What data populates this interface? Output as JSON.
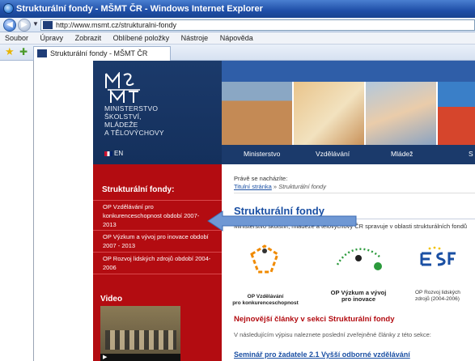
{
  "browser": {
    "title": "Strukturální fondy - MŠMT ČR - Windows Internet Explorer",
    "url": "http://www.msmt.cz/strukturalni-fondy",
    "menu": [
      "Soubor",
      "Úpravy",
      "Zobrazit",
      "Oblíbené položky",
      "Nástroje",
      "Nápověda"
    ],
    "tab_title": "Strukturální fondy - MŠMT ČR"
  },
  "site": {
    "ministry_name": "MINISTERSTVO\nŠKOLSTVÍ,\nMLÁDEŽE\nA TĚLOVÝCHOVY",
    "language": "EN",
    "nav": [
      "Ministerstvo",
      "Vzdělávání",
      "Mládež",
      "S"
    ],
    "sidebar": {
      "title": "Strukturální fondy:",
      "links": [
        "OP Vzdělávání pro konkurenceschopnost období 2007-2013",
        "OP Výzkum a vývoj pro inovace období 2007 - 2013",
        "OP Rozvoj lidských zdrojů období 2004-2006"
      ],
      "video_title": "Video"
    },
    "breadcrumb": {
      "label": "Právě se nacházíte:",
      "home": "Titulní stránka",
      "separator": "»",
      "current": "Strukturální fondy"
    },
    "page_title": "Strukturální fondy",
    "intro": "Ministerstvo školství, mládeže a tělovýchovy ČR spravuje v oblasti strukturálních fondů",
    "op_logos": [
      {
        "caption": "OP Vzdělávání\npro konkurenceschopnost"
      },
      {
        "caption": "OP Výzkum a vývoj\npro inovace"
      },
      {
        "caption": "OP Rozvoj lidských\nzdrojů (2004-2006)"
      }
    ],
    "articles_heading": "Nejnovější články v sekci Strukturální fondy",
    "articles_intro": "V následujícím výpisu naleznete poslední zveřejněné články z této sekce:",
    "article_link": "Seminář pro žadatele 2.1 Vyšší odborné vzdělávání"
  },
  "colors": {
    "sidebar_red": "#b30c11",
    "navy": "#1b3a6b",
    "link_blue": "#1a4fa3",
    "arrow_blue": "#6f98d4"
  }
}
